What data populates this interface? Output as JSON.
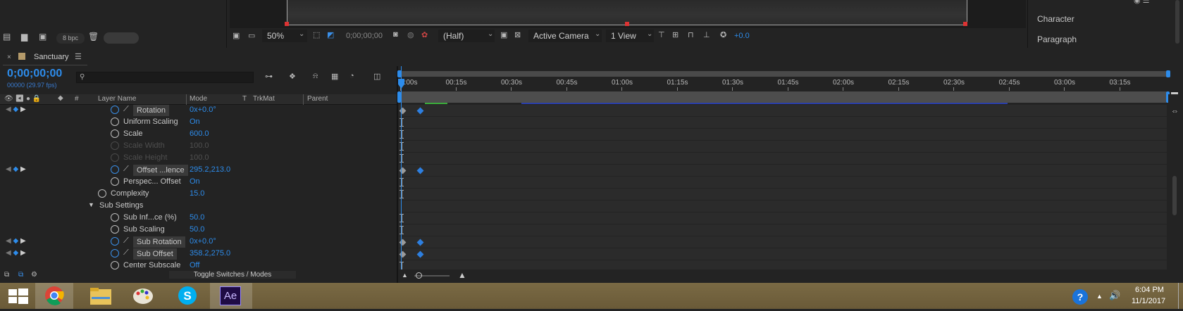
{
  "project": {
    "bpc_label": "8 bpc"
  },
  "viewer_toolbar": {
    "zoom": "50%",
    "timecode": "0;00;00;00",
    "resolution": "(Half)",
    "camera": "Active Camera",
    "views": "1 View",
    "exposure": "+0.0"
  },
  "right_panel": {
    "items": [
      "Character",
      "Paragraph"
    ]
  },
  "timeline": {
    "tab_label": "Sanctuary",
    "timecode": "0;00;00;00",
    "fps_info": "00000 (29.97 fps)",
    "search_placeholder": "",
    "columns": {
      "layer_name": "Layer Name",
      "mode": "Mode",
      "t": "T",
      "trkmat": "TrkMat",
      "parent": "Parent"
    },
    "ruler": [
      "0:00s",
      "00:15s",
      "00:30s",
      "00:45s",
      "01:00s",
      "01:15s",
      "01:30s",
      "01:45s",
      "02:00s",
      "02:15s",
      "02:30s",
      "02:45s",
      "03:00s",
      "03:15s"
    ],
    "footer_toggle": "Toggle Switches / Modes"
  },
  "properties": [
    {
      "name": "Rotation",
      "value": "0x+0.0°"
    },
    {
      "name": "Uniform Scaling",
      "value": "On"
    },
    {
      "name": "Scale",
      "value": "600.0"
    },
    {
      "name": "Scale Width",
      "value": "100.0"
    },
    {
      "name": "Scale Height",
      "value": "100.0"
    },
    {
      "name": "Offset ...lence",
      "value": "295.2,213.0"
    },
    {
      "name": "Perspec... Offset",
      "value": "On"
    },
    {
      "name": "Complexity",
      "value": "15.0"
    },
    {
      "name": "Sub Settings",
      "value": ""
    },
    {
      "name": "Sub Inf...ce (%)",
      "value": "50.0"
    },
    {
      "name": "Sub Scaling",
      "value": "50.0"
    },
    {
      "name": "Sub Rotation",
      "value": "0x+0.0°"
    },
    {
      "name": "Sub Offset",
      "value": "358.2,275.0"
    },
    {
      "name": "Center Subscale",
      "value": "Off"
    }
  ],
  "taskbar": {
    "apps": [
      "windows-start",
      "chrome",
      "file-explorer",
      "paint",
      "skype",
      "after-effects"
    ],
    "ae_label": "Ae",
    "time": "6:04 PM",
    "date": "11/1/2017"
  },
  "colors": {
    "accent": "#2d8ceb",
    "panel": "#232323",
    "graph": "#2b2b2b"
  }
}
